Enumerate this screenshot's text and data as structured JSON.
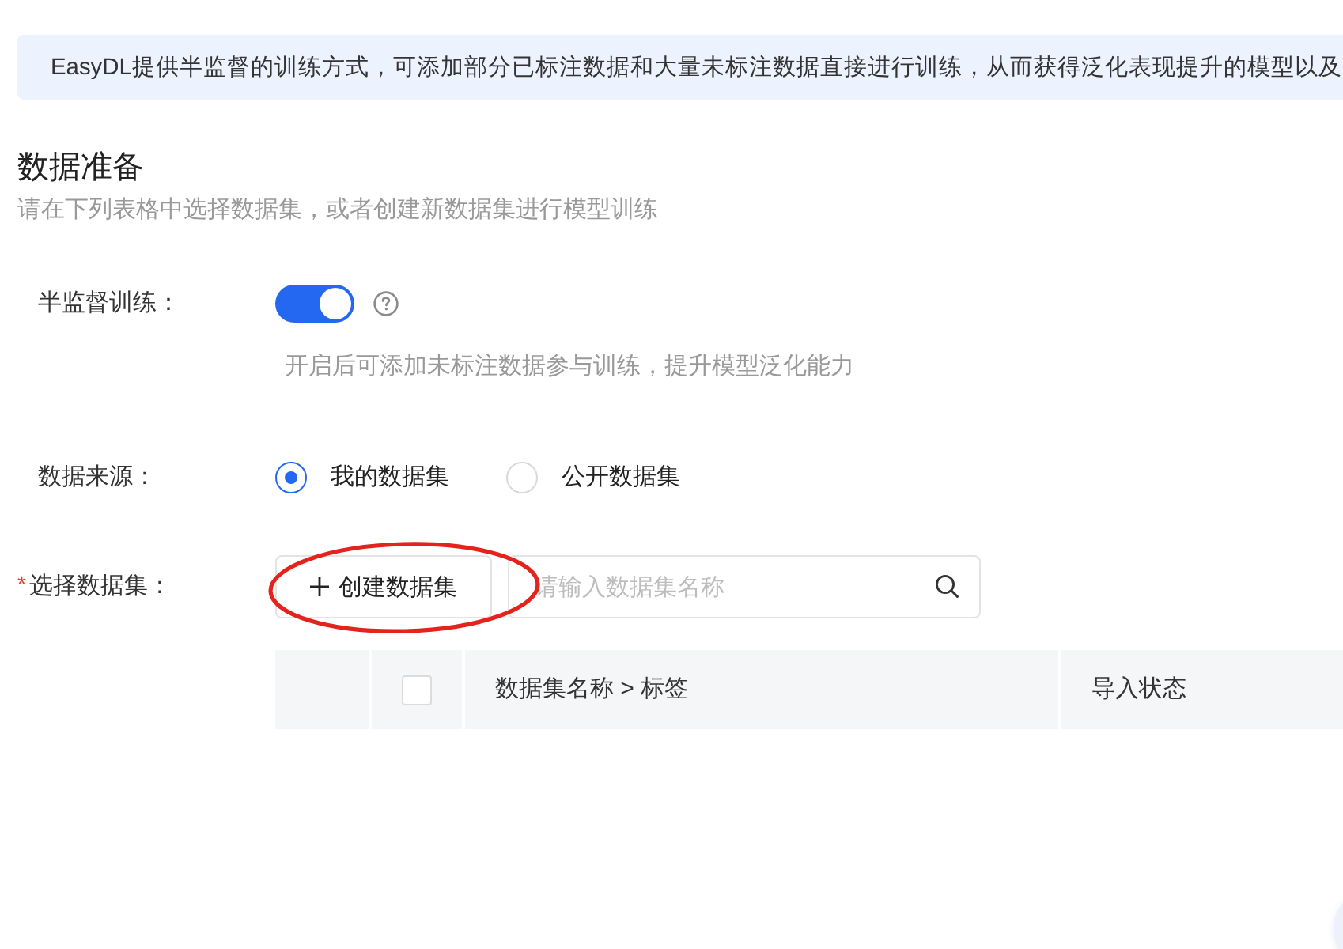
{
  "banner": {
    "text": "EasyDL提供半监督的训练方式，可添加部分已标注数据和大量未标注数据直接进行训练，从而获得泛化表现提升的模型以及"
  },
  "section": {
    "title": "数据准备",
    "subtitle": "请在下列表格中选择数据集，或者创建新数据集进行模型训练"
  },
  "form": {
    "semi_supervised": {
      "label": "半监督训练：",
      "on": true,
      "hint": "开启后可添加未标注数据参与训练，提升模型泛化能力"
    },
    "data_source": {
      "label": "数据来源：",
      "options": [
        {
          "label": "我的数据集",
          "selected": true
        },
        {
          "label": "公开数据集",
          "selected": false
        }
      ]
    },
    "dataset": {
      "required_mark": "*",
      "label": "选择数据集：",
      "create_button": {
        "label": "创建数据集",
        "highlighted": true
      },
      "search": {
        "placeholder": "请输入数据集名称"
      }
    }
  },
  "table": {
    "columns": [
      {
        "kind": "blank"
      },
      {
        "kind": "checkbox",
        "checked": false
      },
      {
        "kind": "text",
        "label": "数据集名称 > 标签"
      },
      {
        "kind": "text",
        "label": "导入状态"
      }
    ]
  }
}
